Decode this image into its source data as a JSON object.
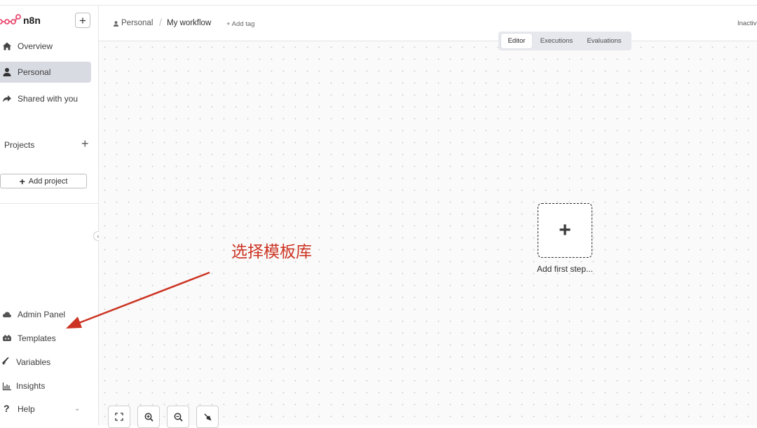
{
  "app": {
    "name": "n8n"
  },
  "sidebar": {
    "new_button": "+",
    "items": [
      {
        "label": "Overview",
        "icon": "home-icon"
      },
      {
        "label": "Personal",
        "icon": "user-icon",
        "active": true
      },
      {
        "label": "Shared with you",
        "icon": "share-icon"
      }
    ],
    "projects_label": "Projects",
    "projects_add": "+",
    "add_project_label": "Add project",
    "bottom_items": [
      {
        "label": "Admin Panel",
        "icon": "cloud-icon"
      },
      {
        "label": "Templates",
        "icon": "templates-icon"
      },
      {
        "label": "Variables",
        "icon": "variables-icon"
      },
      {
        "label": "Insights",
        "icon": "insights-icon"
      },
      {
        "label": "Help",
        "icon": "help-icon"
      }
    ]
  },
  "header": {
    "breadcrumb_project": "Personal",
    "breadcrumb_separator": "/",
    "workflow_name": "My workflow",
    "add_tag": "+ Add tag",
    "status": "Inactiv"
  },
  "tabs": [
    {
      "label": "Editor",
      "active": true
    },
    {
      "label": "Executions"
    },
    {
      "label": "Evaluations"
    }
  ],
  "canvas": {
    "add_step_symbol": "+",
    "add_step_label": "Add first step..."
  },
  "annotation": {
    "text": "选择模板库",
    "color": "#cc3322"
  },
  "colors": {
    "brand": "#ea4b71",
    "active_bg": "#d9dbe3",
    "annotation": "#cc3322"
  }
}
